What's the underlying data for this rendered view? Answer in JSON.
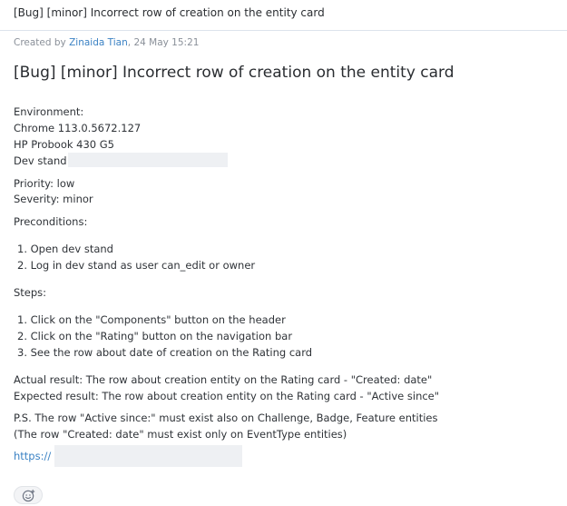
{
  "topbar": {
    "title": "[Bug] [minor] Incorrect row of creation on the entity card"
  },
  "meta": {
    "created_by_prefix": "Created by ",
    "author": "Zinaida Tian",
    "date": ", 24 May 15:21"
  },
  "message": {
    "title": "[Bug] [minor] Incorrect row of creation on the entity card",
    "environment_label": "Environment:",
    "browser": "Chrome 113.0.5672.127",
    "device": "HP Probook 430 G5",
    "stand_label": "Dev stand",
    "priority": "Priority: low",
    "severity": "Severity: minor",
    "preconditions_label": "Preconditions:",
    "preconditions": [
      "1. Open dev stand",
      "2. Log in dev stand as user can_edit or owner"
    ],
    "steps_label": "Steps:",
    "steps": [
      "1. Click on the \"Components\" button on the header",
      "2. Click on the \"Rating\" button on the navigation bar",
      "3. See the row about date of creation on the Rating card"
    ],
    "actual_result": "Actual result: The row about creation entity on the Rating card - \"Created: date\"",
    "expected_result": "Expected result: The row about creation entity on the Rating card - \"Active since\"",
    "ps_line1": "P.S. The row \"Active since:\" must exist also on Challenge, Badge, Feature entities",
    "ps_line2": "(The row \"Created: date\" must exist only on EventType entities)",
    "link_visible": "https://"
  },
  "reaction": {
    "icon": "smiley-add-icon"
  }
}
